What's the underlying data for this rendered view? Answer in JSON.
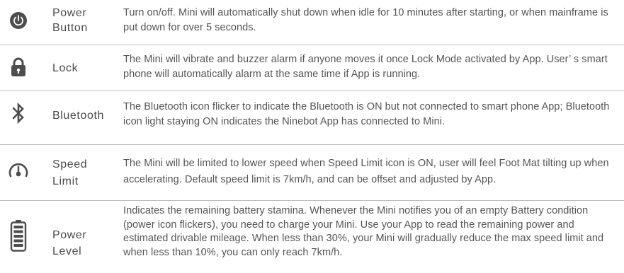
{
  "rows": [
    {
      "icon": "power-icon",
      "label_lines": [
        "Power",
        "Button"
      ],
      "description": "Turn on/off. Mini will automatically shut down when idle for 10 minutes after starting, or when mainframe is put down for over 5 seconds."
    },
    {
      "icon": "lock-icon",
      "label_lines": [
        "Lock"
      ],
      "description": "The Mini will vibrate and buzzer alarm if anyone moves it once Lock Mode activated by App. User’ s smart phone will automatically alarm at the same time if App is running."
    },
    {
      "icon": "bluetooth-icon",
      "label_lines": [
        "Bluetooth"
      ],
      "description": "The Bluetooth icon flicker to indicate the Bluetooth is ON but not connected to smart phone App; Bluetooth icon light staying ON indicates the Ninebot App has connected to Mini."
    },
    {
      "icon": "speedometer-icon",
      "label_lines": [
        "Speed",
        "Limit"
      ],
      "description": "The Mini will be limited to lower speed when Speed Limit icon is ON, user will feel Foot Mat tilting up when accelerating. Default speed limit is 7km/h, and can be offset and adjusted by App."
    },
    {
      "icon": "battery-icon",
      "label_lines": [
        "Power",
        "Level"
      ],
      "description": "Indicates the remaining battery stamina. Whenever the Mini notifies you  of an empty Battery condition (power icon flickers),  you need to charge your Mini. Use your App to read the remaining power and estimated drivable mileage. When less than 30%, your Mini will gradually reduce the max speed limit and when less than 10%, you can only reach 7km/h."
    }
  ],
  "colors": {
    "icon": "#4d4d4d",
    "text": "#555555",
    "divider": "#bdbdbd"
  }
}
